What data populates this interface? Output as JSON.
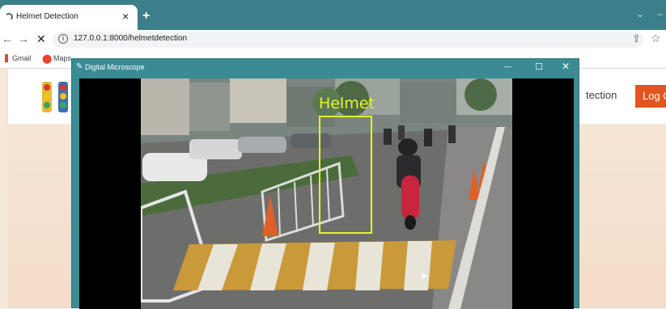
{
  "browser": {
    "tab_title": "Helmet Detection",
    "tab_close": "×",
    "new_tab": "+",
    "url": "127.0.0.1:8000/helmetdetection",
    "back": "←",
    "forward": "→",
    "stop": "✕",
    "bookmarks": [
      "Gmail",
      "Maps"
    ],
    "window_controls": [
      "⌄",
      "–"
    ]
  },
  "app": {
    "nav_link": "Detection",
    "nav_link_visible": "tection",
    "logout_label": "Log Out",
    "logout_visible": "Log Ou"
  },
  "popup": {
    "title": "Digital Microscope",
    "controls": [
      "—",
      "☐",
      "✕"
    ],
    "detection": {
      "label": "Helmet",
      "box_color": "#e6f22a"
    }
  },
  "colors": {
    "tabbar": "#3c7e8a",
    "popup_frame": "#3b8b95",
    "logout_button": "#e2551f",
    "page_bg": "#f7e9da"
  }
}
